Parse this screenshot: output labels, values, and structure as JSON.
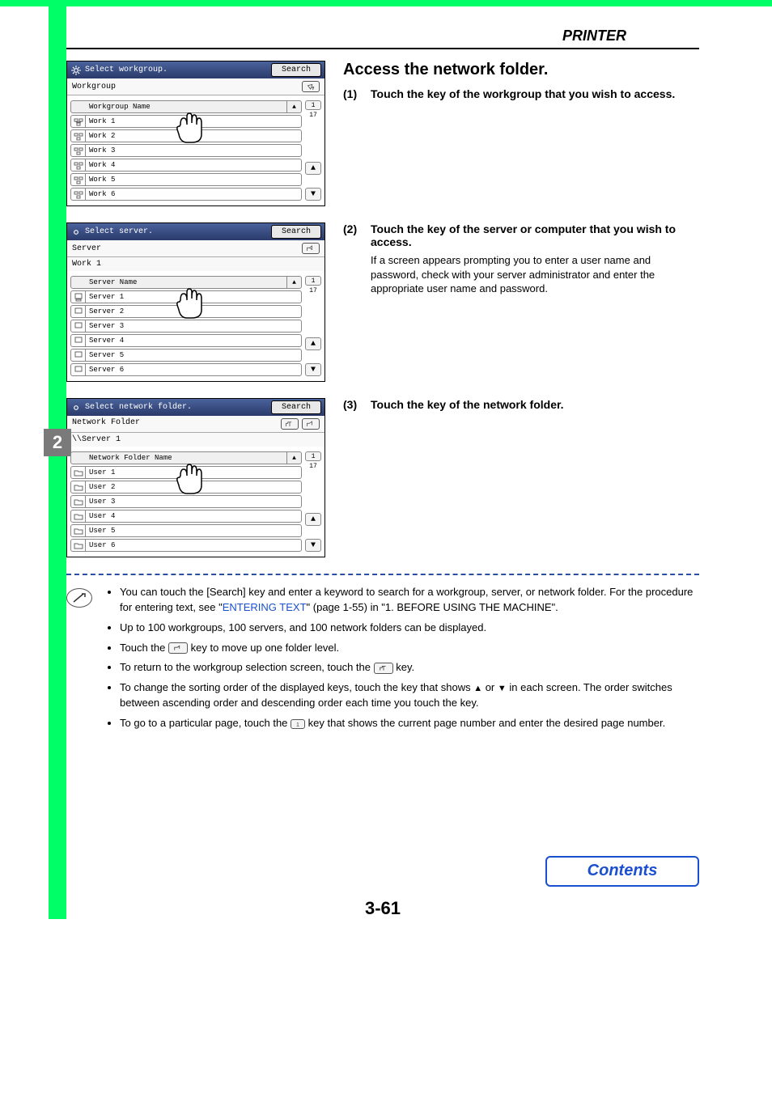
{
  "header": {
    "title": "PRINTER"
  },
  "step_badge": "2",
  "panels": {
    "workgroup": {
      "title": "Select workgroup.",
      "search": "Search",
      "sub_label": "Workgroup",
      "list_header": "Workgroup Name",
      "rows": [
        "Work 1",
        "Work 2",
        "Work 3",
        "Work 4",
        "Work 5",
        "Work 6"
      ],
      "page_cur": "1",
      "page_total": "17"
    },
    "server": {
      "title": "Select server.",
      "search": "Search",
      "sub_label": "Server",
      "path": "Work 1",
      "list_header": "Server Name",
      "rows": [
        "Server 1",
        "Server 2",
        "Server 3",
        "Server 4",
        "Server 5",
        "Server 6"
      ],
      "page_cur": "1",
      "page_total": "17"
    },
    "folder": {
      "title": "Select network folder.",
      "search": "Search",
      "sub_label": "Network Folder",
      "path": "\\\\Server 1",
      "list_header": "Network Folder Name",
      "rows": [
        "User 1",
        "User 2",
        "User 3",
        "User 4",
        "User 5",
        "User 6"
      ],
      "page_cur": "1",
      "page_total": "17"
    }
  },
  "right": {
    "heading": "Access the network folder.",
    "s1_num": "(1)",
    "s1_text": "Touch the key of the workgroup that you wish to access.",
    "s2_num": "(2)",
    "s2_text": "Touch the key of the server or computer that you wish to access.",
    "s2_note": "If a screen appears prompting you to enter a user name and password, check with your server administrator and enter the appropriate user name and password.",
    "s3_num": "(3)",
    "s3_text": "Touch the key of the network folder."
  },
  "notes": {
    "n1a": "You can touch the [Search] key and enter a keyword to search for a workgroup, server, or network folder. For the procedure for entering text, see \"",
    "n1link": "ENTERING TEXT",
    "n1b": "\" (page 1-55) in \"1. BEFORE USING THE MACHINE\".",
    "n2": "Up to 100 workgroups, 100 servers, and 100 network folders can be displayed.",
    "n3a": "Touch the ",
    "n3b": " key to move up one folder level.",
    "n4a": "To return to the workgroup selection screen, touch the ",
    "n4b": " key.",
    "n5a": "To change the sorting order of the displayed keys, touch the key that shows ",
    "n5b": " or ",
    "n5c": " in each screen. The order switches between ascending order and descending order each time you touch the key.",
    "n6a": "To go to a particular page, touch the ",
    "n6b": " key that shows the current page number and enter the desired page number."
  },
  "footer": {
    "page": "3-61",
    "contents": "Contents"
  }
}
